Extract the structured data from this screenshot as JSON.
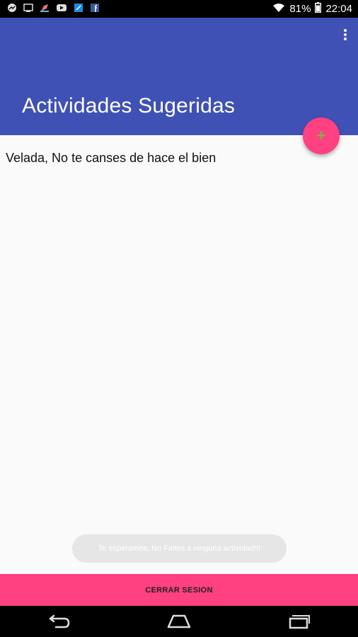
{
  "status_bar": {
    "notification_icons": [
      "messenger-icon",
      "screen-icon",
      "paint-icon",
      "youtube-icon",
      "app-icon",
      "facebook-icon"
    ],
    "battery": "81%",
    "time": "22:04"
  },
  "app_bar": {
    "title": "Actividades Sugeridas",
    "background": "#3f51b5"
  },
  "fab": {
    "label": "+",
    "color": "#ff4081"
  },
  "activities": [
    {
      "text": "Velada, No te canses de hace el bien"
    }
  ],
  "toast": {
    "text": "Te esperamos, No Faltes a ninguna actividad!!!"
  },
  "logout_button": {
    "label": "CERRAR SESION",
    "color": "#ff4081"
  },
  "nav_bar": {
    "icons": [
      "back-icon",
      "home-icon",
      "recent-apps-icon"
    ]
  }
}
